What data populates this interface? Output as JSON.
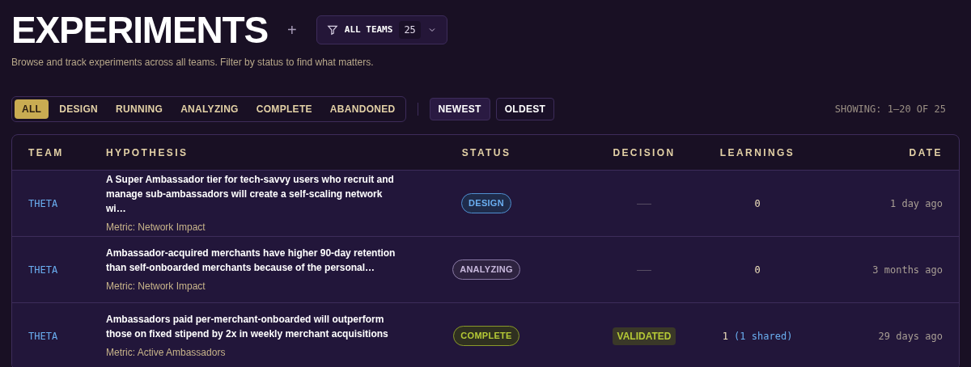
{
  "header": {
    "title": "EXPERIMENTS",
    "add": "+",
    "team_filter": {
      "label": "ALL TEAMS",
      "count": "25"
    },
    "subtitle": "Browse and track experiments across all teams. Filter by status to find what matters."
  },
  "status_filters": [
    {
      "label": "ALL",
      "selected": true
    },
    {
      "label": "DESIGN",
      "selected": false
    },
    {
      "label": "RUNNING",
      "selected": false
    },
    {
      "label": "ANALYZING",
      "selected": false
    },
    {
      "label": "COMPLETE",
      "selected": false
    },
    {
      "label": "ABANDONED",
      "selected": false
    }
  ],
  "sort": [
    {
      "label": "NEWEST",
      "selected": true
    },
    {
      "label": "OLDEST",
      "selected": false
    }
  ],
  "showing": "SHOWING: 1–20 OF 25",
  "table": {
    "columns": [
      "TEAM",
      "HYPOTHESIS",
      "STATUS",
      "DECISION",
      "LEARNINGS",
      "DATE"
    ],
    "rows": [
      {
        "team": "THETA",
        "hypothesis": "A Super Ambassador tier for tech-savvy users who recruit and manage sub-ambassadors will create a self-scaling network wi…",
        "metric": "Metric: Network Impact",
        "status": {
          "kind": "design",
          "label": "DESIGN"
        },
        "decision": {
          "kind": "none",
          "label": "———"
        },
        "learnings": {
          "count": "0"
        },
        "date": "1 day ago"
      },
      {
        "team": "THETA",
        "hypothesis": "Ambassador-acquired merchants have higher 90-day retention than self-onboarded merchants because of the personal…",
        "metric": "Metric: Network Impact",
        "status": {
          "kind": "analyzing",
          "label": "ANALYZING"
        },
        "decision": {
          "kind": "none",
          "label": "———"
        },
        "learnings": {
          "count": "0"
        },
        "date": "3 months ago"
      },
      {
        "team": "THETA",
        "hypothesis": "Ambassadors paid per-merchant-onboarded will outperform those on fixed stipend by 2x in weekly merchant acquisitions",
        "metric": "Metric: Active Ambassadors",
        "status": {
          "kind": "complete",
          "label": "COMPLETE"
        },
        "decision": {
          "kind": "validated",
          "label": "VALIDATED"
        },
        "learnings": {
          "count": "1",
          "shared": "(1 shared)"
        },
        "date": "29 days ago"
      }
    ]
  }
}
